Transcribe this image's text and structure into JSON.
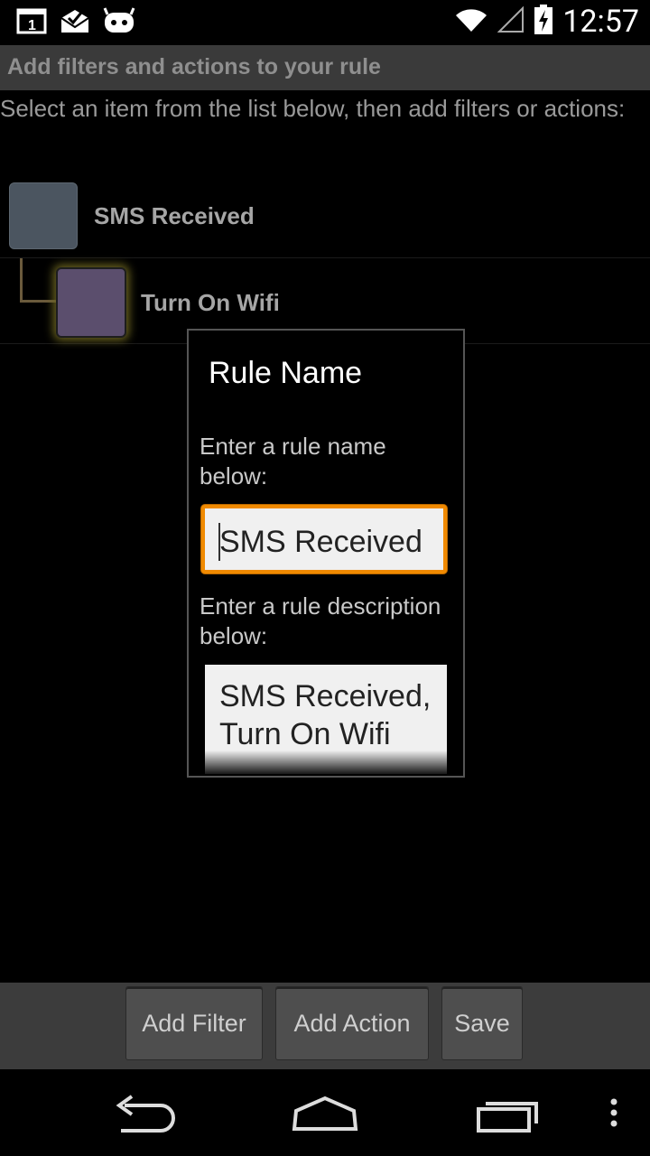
{
  "status_bar": {
    "notification_icons": [
      "calendar-icon",
      "mail-icon",
      "cyanogen-icon"
    ],
    "status_icons": [
      "wifi-icon",
      "signal-icon",
      "battery-charging-icon"
    ],
    "time": "12:57",
    "calendar_day": "1"
  },
  "title_bar": {
    "title": "Add filters and actions to your rule"
  },
  "instructions": "Select an item from the list below, then add filters or actions:",
  "rule_items": [
    {
      "label": "SMS Received",
      "color": "#4b5560"
    },
    {
      "label": "Turn On Wifi",
      "color": "#5b4e6d"
    }
  ],
  "dialog": {
    "title": "Rule Name",
    "name_label": "Enter a rule name below:",
    "name_value": "SMS Received",
    "description_label": "Enter a rule description below:",
    "description_value": "SMS Received, Turn On Wifi"
  },
  "buttons": {
    "add_filter": "Add Filter",
    "add_action": "Add Action",
    "save": "Save"
  },
  "accent_color": "#f08a00",
  "nav_icons": [
    "back-icon",
    "home-icon",
    "recents-icon",
    "menu-icon"
  ]
}
